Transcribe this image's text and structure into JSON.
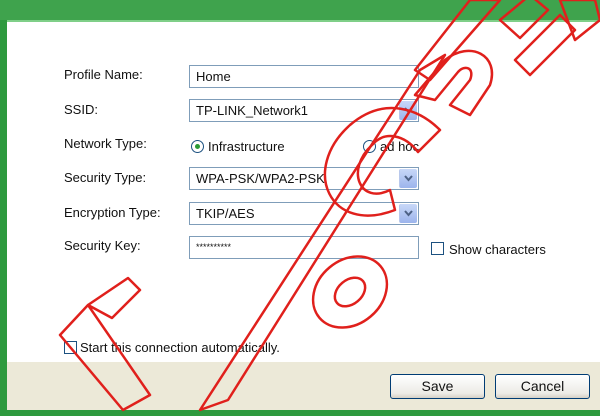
{
  "profile": {
    "name_label": "Profile Name:",
    "name_value": "Home"
  },
  "ssid": {
    "label": "SSID:",
    "value": "TP-LINK_Network1"
  },
  "network_type": {
    "label": "Network Type:",
    "options": [
      {
        "label": "Infrastructure",
        "selected": true
      },
      {
        "label": "ad hoc",
        "selected": false
      }
    ]
  },
  "security_type": {
    "label": "Security Type:",
    "value": "WPA-PSK/WPA2-PSK"
  },
  "encryption_type": {
    "label": "Encryption Type:",
    "value": "TKIP/AES"
  },
  "security_key": {
    "label": "Security Key:",
    "value": "**********",
    "show_characters_label": "Show characters"
  },
  "auto_connect": {
    "label": "Start this connection automatically."
  },
  "buttons": {
    "save": "Save",
    "cancel": "Cancel"
  },
  "colors": {
    "frame_green": "#2e9a3e",
    "watermark_red": "#e0201c",
    "button_bar": "#ece9d8"
  }
}
